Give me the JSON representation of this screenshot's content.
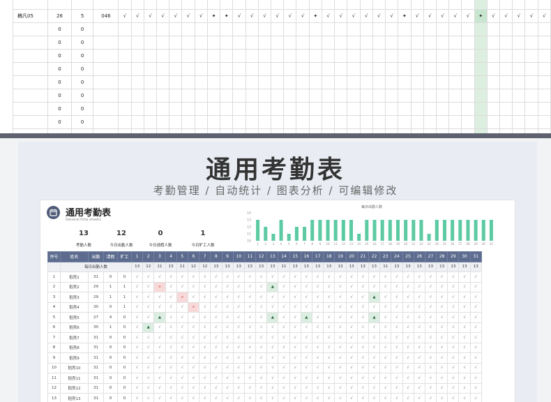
{
  "top_sheet": {
    "first_row": {
      "name": "稿凡05",
      "c1": "26",
      "c2": "5",
      "c3": "046",
      "marks": [
        "√",
        "√",
        "√",
        "√",
        "√",
        "√",
        "√",
        "✦",
        "✦",
        "√",
        "√",
        "√",
        "√",
        "√",
        "√",
        "✦",
        "√",
        "√",
        "√",
        "√",
        "√",
        "√",
        "✦",
        "√",
        "√",
        "√",
        "√",
        "√",
        "✦",
        "√",
        "√",
        "√",
        "√",
        "√"
      ]
    },
    "rows": [
      {
        "c1": "0",
        "c2": "0"
      },
      {
        "c1": "0",
        "c2": "0"
      },
      {
        "c1": "0",
        "c2": "0"
      },
      {
        "c1": "0",
        "c2": "0"
      },
      {
        "c1": "0",
        "c2": "0"
      },
      {
        "c1": "0",
        "c2": "0"
      },
      {
        "c1": "0",
        "c2": "0"
      },
      {
        "c1": "0",
        "c2": "0"
      },
      {
        "c1": "0",
        "c2": "0"
      }
    ]
  },
  "banner": {
    "title": "通用考勤表",
    "subtitle": "考勤管理 / 自动统计 / 图表分析 / 可编辑修改"
  },
  "sheet": {
    "title": "通用考勤表",
    "subtitle": "General time sheets",
    "icon": "calendar-icon",
    "stats": [
      {
        "value": "13",
        "label": "考勤人数"
      },
      {
        "value": "12",
        "label": "今日出勤人数"
      },
      {
        "value": "0",
        "label": "今日请假人数"
      },
      {
        "value": "1",
        "label": "今日旷工人数"
      }
    ],
    "headers": [
      "序号",
      "姓名",
      "出勤",
      "请假",
      "旷工"
    ],
    "sub_label": "每日出勤人数",
    "days": [
      "1",
      "2",
      "3",
      "4",
      "5",
      "6",
      "7",
      "8",
      "9",
      "10",
      "11",
      "12",
      "13",
      "14",
      "15",
      "16",
      "17",
      "18",
      "19",
      "20",
      "21",
      "22",
      "23",
      "24",
      "25",
      "26",
      "27",
      "28",
      "29",
      "30",
      "31"
    ],
    "daily_counts": [
      "13",
      "12",
      "11",
      "13",
      "11",
      "12",
      "12",
      "13",
      "13",
      "13",
      "13",
      "13",
      "13",
      "11",
      "13",
      "13",
      "13",
      "13",
      "13",
      "13",
      "13",
      "13",
      "11",
      "13",
      "13",
      "13",
      "13",
      "13",
      "13",
      "13",
      "13"
    ],
    "rows": [
      {
        "no": "1",
        "name": "稻壳1",
        "att": "31",
        "leave": "0",
        "absent": "0",
        "marks": {}
      },
      {
        "no": "2",
        "name": "稻壳2",
        "att": "29",
        "leave": "1",
        "absent": "1",
        "marks": {
          "3": "x",
          "13": "▲"
        }
      },
      {
        "no": "3",
        "name": "稻壳3",
        "att": "29",
        "leave": "1",
        "absent": "1",
        "marks": {
          "5": "x",
          "22": "▲"
        }
      },
      {
        "no": "4",
        "name": "稻壳4",
        "att": "30",
        "leave": "0",
        "absent": "1",
        "marks": {
          "6": "x"
        }
      },
      {
        "no": "5",
        "name": "稻壳5",
        "att": "27",
        "leave": "4",
        "absent": "0",
        "marks": {
          "3": "▲",
          "13": "▲",
          "16": "▲",
          "22": "▲"
        }
      },
      {
        "no": "6",
        "name": "稻壳6",
        "att": "30",
        "leave": "1",
        "absent": "0",
        "marks": {
          "2": "▲"
        }
      },
      {
        "no": "7",
        "name": "稻壳7",
        "att": "31",
        "leave": "0",
        "absent": "0",
        "marks": {}
      },
      {
        "no": "8",
        "name": "稻壳8",
        "att": "31",
        "leave": "0",
        "absent": "0",
        "marks": {}
      },
      {
        "no": "9",
        "name": "稻壳9",
        "att": "31",
        "leave": "0",
        "absent": "0",
        "marks": {}
      },
      {
        "no": "10",
        "name": "稻壳10",
        "att": "31",
        "leave": "0",
        "absent": "0",
        "marks": {}
      },
      {
        "no": "11",
        "name": "稻壳11",
        "att": "31",
        "leave": "0",
        "absent": "0",
        "marks": {}
      },
      {
        "no": "12",
        "name": "稻壳12",
        "att": "31",
        "leave": "0",
        "absent": "0",
        "marks": {}
      },
      {
        "no": "13",
        "name": "稻壳13",
        "att": "31",
        "leave": "0",
        "absent": "0",
        "marks": {}
      }
    ],
    "check_mark": "√"
  },
  "chart_data": {
    "type": "bar",
    "title": "每日出勤人数",
    "categories": [
      "1",
      "2",
      "3",
      "4",
      "5",
      "6",
      "7",
      "8",
      "9",
      "10",
      "11",
      "12",
      "13",
      "14",
      "15",
      "16",
      "17",
      "18",
      "19",
      "20",
      "21",
      "22",
      "23",
      "24",
      "25",
      "26",
      "27",
      "28",
      "29",
      "30",
      "31"
    ],
    "values": [
      13,
      12,
      11,
      13,
      11,
      12,
      12,
      13,
      13,
      13,
      13,
      13,
      13,
      11,
      13,
      13,
      13,
      13,
      13,
      13,
      13,
      13,
      11,
      13,
      13,
      13,
      13,
      13,
      13,
      13,
      13
    ],
    "ylim": [
      10,
      14
    ],
    "yticks": [
      "10",
      "11",
      "12",
      "13",
      "14"
    ],
    "bar_color": "#5ccaa2"
  }
}
